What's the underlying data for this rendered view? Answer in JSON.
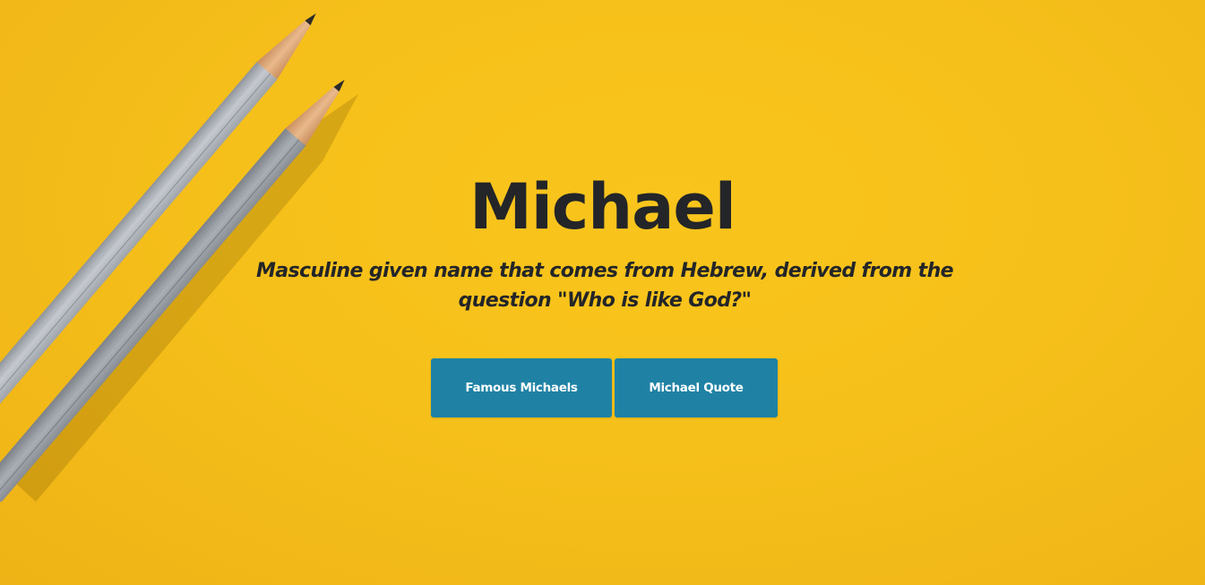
{
  "hero": {
    "background_color": "#f7c21a",
    "title": "Michael",
    "subtitle": "Masculine given name that comes from Hebrew, derived from the question \"Who is like God?\"",
    "decoration": "two-pencils-image"
  },
  "buttons": {
    "famous_label": "Famous Michaels",
    "quote_label": "Michael Quote",
    "color": "#1f82a4"
  }
}
